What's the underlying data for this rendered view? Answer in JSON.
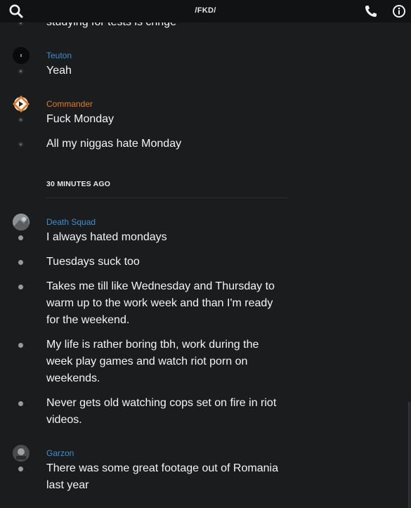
{
  "header": {
    "title": "/FKD/"
  },
  "messages": {
    "m0": "studying for tests is cringe",
    "m1": "Yeah",
    "m2": "Fuck Monday",
    "m3": "All my niggas hate Monday",
    "m4": "I always hated mondays",
    "m5": "Tuesdays suck too",
    "m6": "Takes me till like Wednesday and Thursday to warm up to the work week and than I'm ready for the weekend.",
    "m7": "My life is rather boring tbh, work during the week play games and watch riot porn on weekends.",
    "m8": "Never gets old watching cops set on fire in riot videos.",
    "m9": "There was some great footage out of Romania last year"
  },
  "users": {
    "u1": {
      "name": "Teuton",
      "color": "#3d8fd1"
    },
    "u2": {
      "name": "Commander",
      "color": "#e07b24"
    },
    "u3": {
      "name": "Death Squad",
      "color": "#3d8fd1"
    },
    "u4": {
      "name": "Garzon",
      "color": "#3d8fd1"
    }
  },
  "divider": {
    "label": "30 MINUTES AGO"
  },
  "icons": {
    "search": "search-icon",
    "phone": "phone-icon",
    "info": "info-icon"
  }
}
